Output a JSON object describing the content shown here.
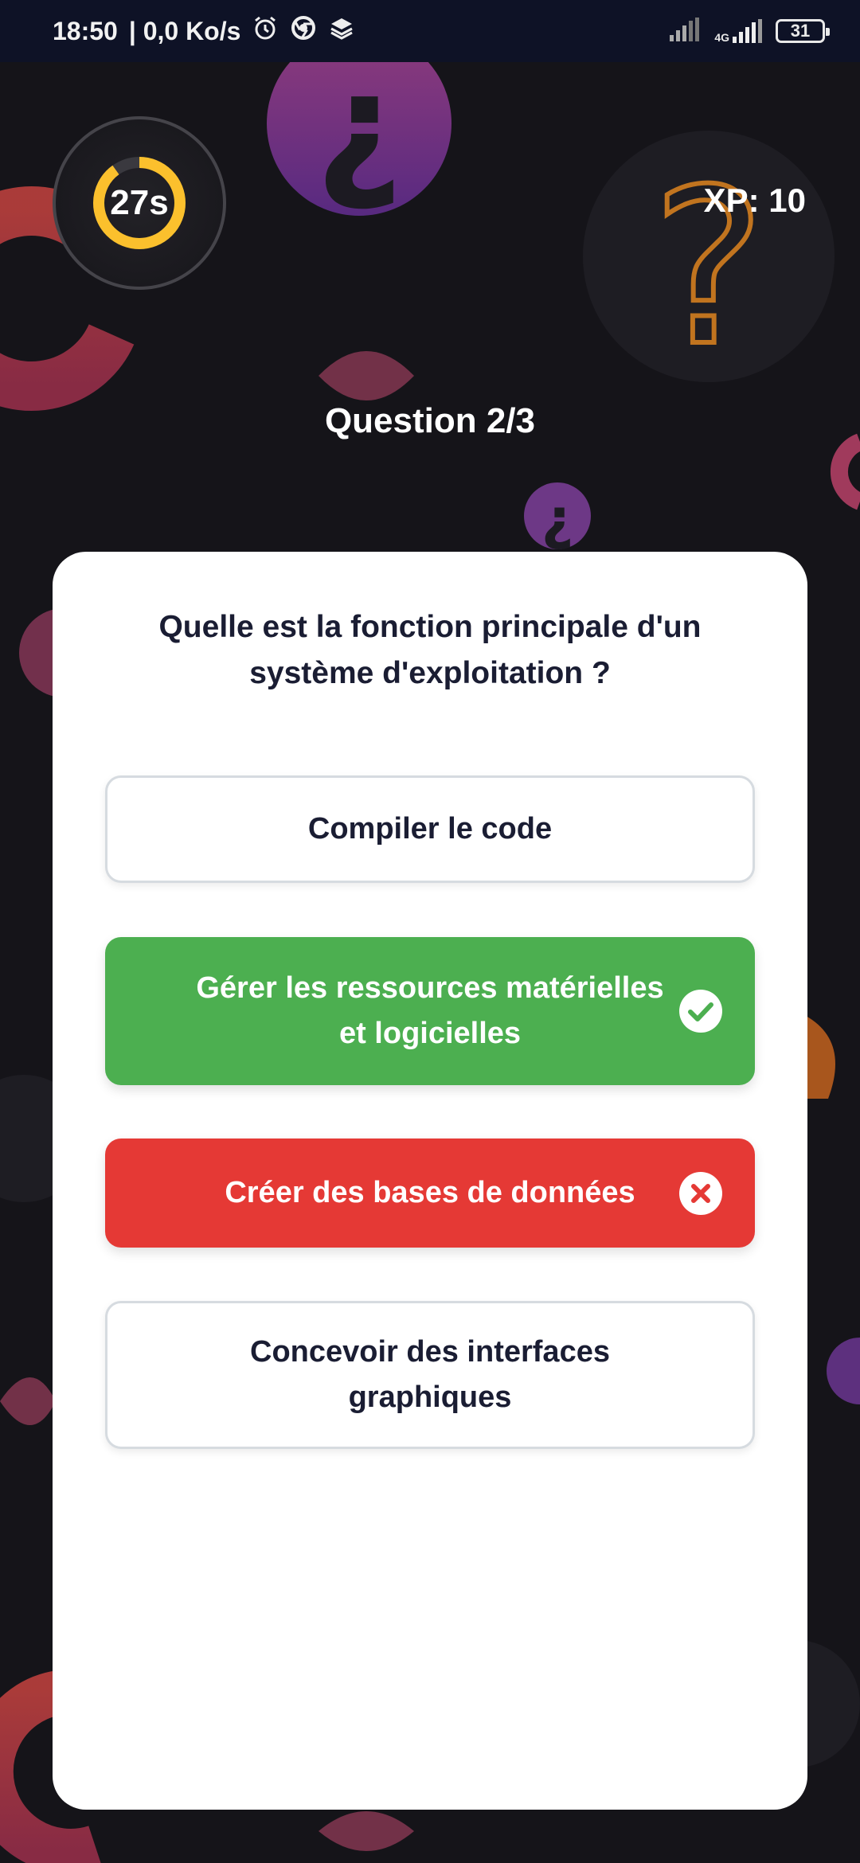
{
  "status_bar": {
    "time": "18:50",
    "network_speed": "| 0,0 Ko/s",
    "network_type": "4G",
    "battery": "31",
    "icons": [
      "alarm-icon",
      "chrome-icon",
      "layers-icon",
      "signal-icon",
      "signal-4g-icon",
      "battery-icon"
    ]
  },
  "quiz": {
    "timer_label": "27s",
    "timer_fraction": 0.9,
    "xp_label": "XP: 10",
    "counter_label": "Question 2/3",
    "question": "Quelle est la fonction principale d'un système d'exploitation ?",
    "options": [
      {
        "label": "Compiler le code",
        "state": "neutral"
      },
      {
        "label": "Gérer les ressources matérielles et logicielles",
        "state": "correct",
        "icon": "check-circle-icon"
      },
      {
        "label": "Créer des bases de données",
        "state": "wrong",
        "icon": "x-circle-icon"
      },
      {
        "label": "Concevoir des interfaces graphiques",
        "state": "neutral"
      }
    ]
  },
  "colors": {
    "background": "#151419",
    "status_bar": "#0e1226",
    "correct": "#4caf50",
    "wrong": "#e53935",
    "timer_accent": "#fbc02d",
    "text_dark": "#1a1d33"
  }
}
